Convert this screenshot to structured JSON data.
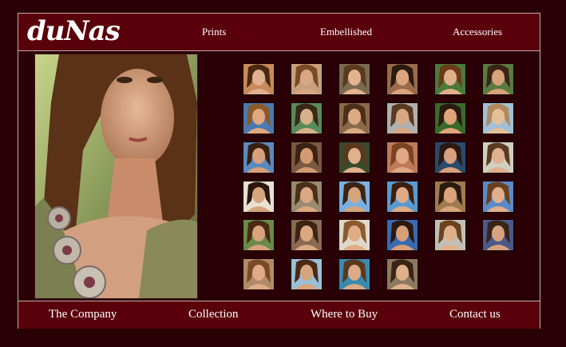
{
  "logo": "duNas",
  "topnav": [
    {
      "label": "Prints"
    },
    {
      "label": "Embellished"
    },
    {
      "label": "Accessories"
    }
  ],
  "main_photo": {
    "subject": "model-portrait"
  },
  "thumbnails": [
    {
      "bg": "#c98a5a",
      "sk": "#e0b090",
      "hr": "#4a2814"
    },
    {
      "bg": "#c8a080",
      "sk": "#d8a883",
      "hr": "#7a4a22"
    },
    {
      "bg": "#7a6a50",
      "sk": "#e3b390",
      "hr": "#5a3a1e"
    },
    {
      "bg": "#9a6a4a",
      "sk": "#d9a47e",
      "hr": "#2a1a10"
    },
    {
      "bg": "#4a7a3a",
      "sk": "#e0b08a",
      "hr": "#6a3a1a"
    },
    {
      "bg": "#5a7a40",
      "sk": "#d8a27a",
      "hr": "#3a2414"
    },
    {
      "bg": "#4a7ab0",
      "sk": "#e0a880",
      "hr": "#8a5a2a"
    },
    {
      "bg": "#5a8a5a",
      "sk": "#d8b08a",
      "hr": "#3a2818"
    },
    {
      "bg": "#8a6a4a",
      "sk": "#dcaa82",
      "hr": "#4a3018"
    },
    {
      "bg": "#b0b0b0",
      "sk": "#d9a683",
      "hr": "#5a3a20"
    },
    {
      "bg": "#3a6a2a",
      "sk": "#e0a478",
      "hr": "#2a1a10"
    },
    {
      "bg": "#a0c0d8",
      "sk": "#e6be98",
      "hr": "#b08a5a"
    },
    {
      "bg": "#5a8ac0",
      "sk": "#d8a07a",
      "hr": "#3a2010"
    },
    {
      "bg": "#7a5a40",
      "sk": "#d49a74",
      "hr": "#3a2214"
    },
    {
      "bg": "#3a4a2a",
      "sk": "#e0b08a",
      "hr": "#5a3820"
    },
    {
      "bg": "#c07a5a",
      "sk": "#e0a884",
      "hr": "#7a4424"
    },
    {
      "bg": "#2a4a6a",
      "sk": "#d8a07c",
      "hr": "#2a1a10"
    },
    {
      "bg": "#d0d0c0",
      "sk": "#e0b090",
      "hr": "#5a3a20"
    },
    {
      "bg": "#e8e0d0",
      "sk": "#d8a47e",
      "hr": "#2a1810"
    },
    {
      "bg": "#9a8a70",
      "sk": "#dca882",
      "hr": "#4a3018"
    },
    {
      "bg": "#7ab0e0",
      "sk": "#d8a47c",
      "hr": "#3a2414"
    },
    {
      "bg": "#5a9ad0",
      "sk": "#e0aa84",
      "hr": "#3a2010"
    },
    {
      "bg": "#a07a50",
      "sk": "#dca47c",
      "hr": "#2a1a10"
    },
    {
      "bg": "#5a8ac8",
      "sk": "#e0b08a",
      "hr": "#6a4020"
    },
    {
      "bg": "#6a8a4a",
      "sk": "#d8a27c",
      "hr": "#4a2a14"
    },
    {
      "bg": "#8a6a50",
      "sk": "#dca880",
      "hr": "#3a2414"
    },
    {
      "bg": "#e0d8c8",
      "sk": "#e0ac86",
      "hr": "#8a5a30"
    },
    {
      "bg": "#3a6ab0",
      "sk": "#d8a07a",
      "hr": "#2a1a10"
    },
    {
      "bg": "#c0c0b8",
      "sk": "#e0b08c",
      "hr": "#6a4220"
    },
    {
      "bg": "#4a5a8a",
      "sk": "#d8a27e",
      "hr": "#3a2418"
    },
    {
      "bg": "#b08a6a",
      "sk": "#e0aa84",
      "hr": "#7a4a24"
    },
    {
      "bg": "#9ac0d8",
      "sk": "#d8a47e",
      "hr": "#4a2a14"
    },
    {
      "bg": "#3a8ab0",
      "sk": "#dcaa84",
      "hr": "#5a3820"
    },
    {
      "bg": "#8a7a60",
      "sk": "#e0b08a",
      "hr": "#3a2414"
    }
  ],
  "bottomnav": [
    {
      "label": "The Company"
    },
    {
      "label": "Collection"
    },
    {
      "label": "Where to Buy"
    },
    {
      "label": "Contact us"
    }
  ]
}
